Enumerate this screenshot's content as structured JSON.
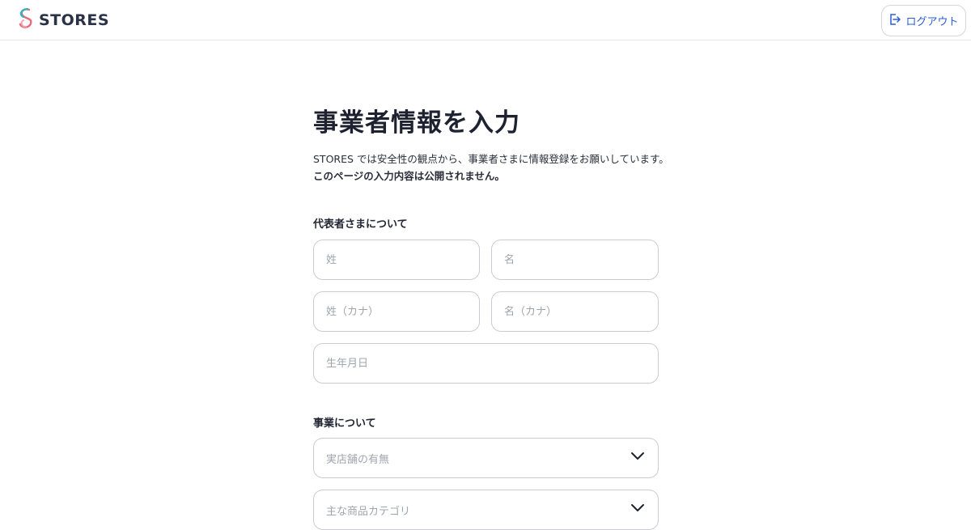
{
  "header": {
    "logo_text": "STORES",
    "logout_label": "ログアウト"
  },
  "main": {
    "title": "事業者情報を入力",
    "intro_line1": "STORES では安全性の観点から、事業者さまに情報登録をお願いしています。",
    "intro_line2": "このページの入力内容は公開されません。",
    "representative": {
      "section_label": "代表者さまについて",
      "last_name_placeholder": "姓",
      "first_name_placeholder": "名",
      "last_name_kana_placeholder": "姓（カナ）",
      "first_name_kana_placeholder": "名（カナ）",
      "birthdate_placeholder": "生年月日"
    },
    "business": {
      "section_label": "事業について",
      "physical_store_placeholder": "実店舗の有無",
      "category_placeholder": "主な商品カテゴリ"
    }
  },
  "colors": {
    "accent": "#2a5bd7",
    "border": "#c9ccd3",
    "text": "#1e2230"
  }
}
